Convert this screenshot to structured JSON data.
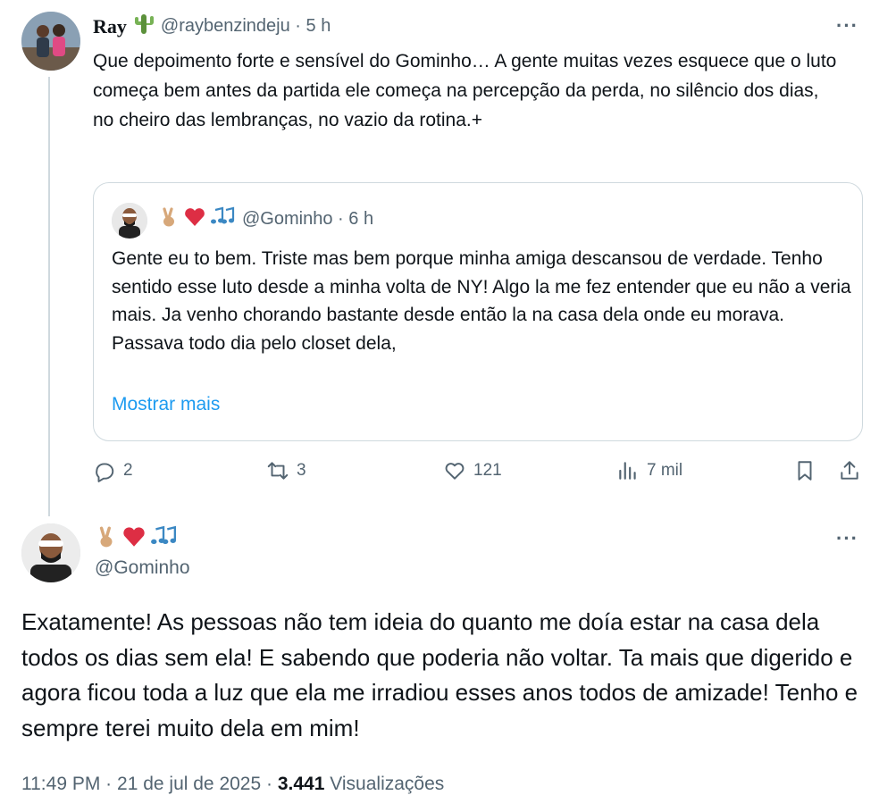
{
  "reply": {
    "author_name": "Ray",
    "name_emoji": "cactus-emoji",
    "handle": "@raybenzindeju",
    "separator": "·",
    "time": "5 h",
    "text": "Que depoimento forte e sensível do Gominho… A gente muitas vezes esquece que o luto começa bem antes da partida  ele começa na percepção da perda, no silêncio dos dias, no cheiro das lembranças, no vazio da rotina.+",
    "quote": {
      "emojis": [
        "victory-hand-emoji",
        "red-heart-emoji",
        "musical-notes-emoji"
      ],
      "handle": "@Gominho",
      "separator": "·",
      "time": "6 h",
      "text": "Gente eu to bem. Triste mas bem porque minha amiga descansou de verdade. Tenho sentido esse luto desde a minha volta de NY! Algo la me fez entender que eu não a veria mais. Ja venho chorando bastante desde então la na casa dela onde eu morava. Passava todo dia pelo closet dela,",
      "show_more": "Mostrar mais"
    },
    "actions": {
      "replies": "2",
      "reposts": "3",
      "likes": "121",
      "views": "7 mil"
    }
  },
  "main": {
    "emojis": [
      "victory-hand-emoji",
      "red-heart-emoji",
      "musical-notes-emoji"
    ],
    "handle": "@Gominho",
    "text": "Exatamente! As pessoas não tem ideia do quanto me doía estar na casa dela todos os dias sem ela! E sabendo que poderia não voltar. Ta mais que digerido e agora ficou toda a luz que ela me irradiou esses anos todos de amizade! Tenho e sempre terei muito dela em mim!",
    "time": "11:49 PM",
    "separator": "·",
    "date": "21 de jul de 2025",
    "separator2": "·",
    "views_count": "3.441",
    "views_label": "Visualizações"
  },
  "more_label": "···",
  "colors": {
    "accent": "#1d9bf0",
    "muted": "#536471",
    "border": "#cfd9de",
    "text": "#0f1419"
  }
}
